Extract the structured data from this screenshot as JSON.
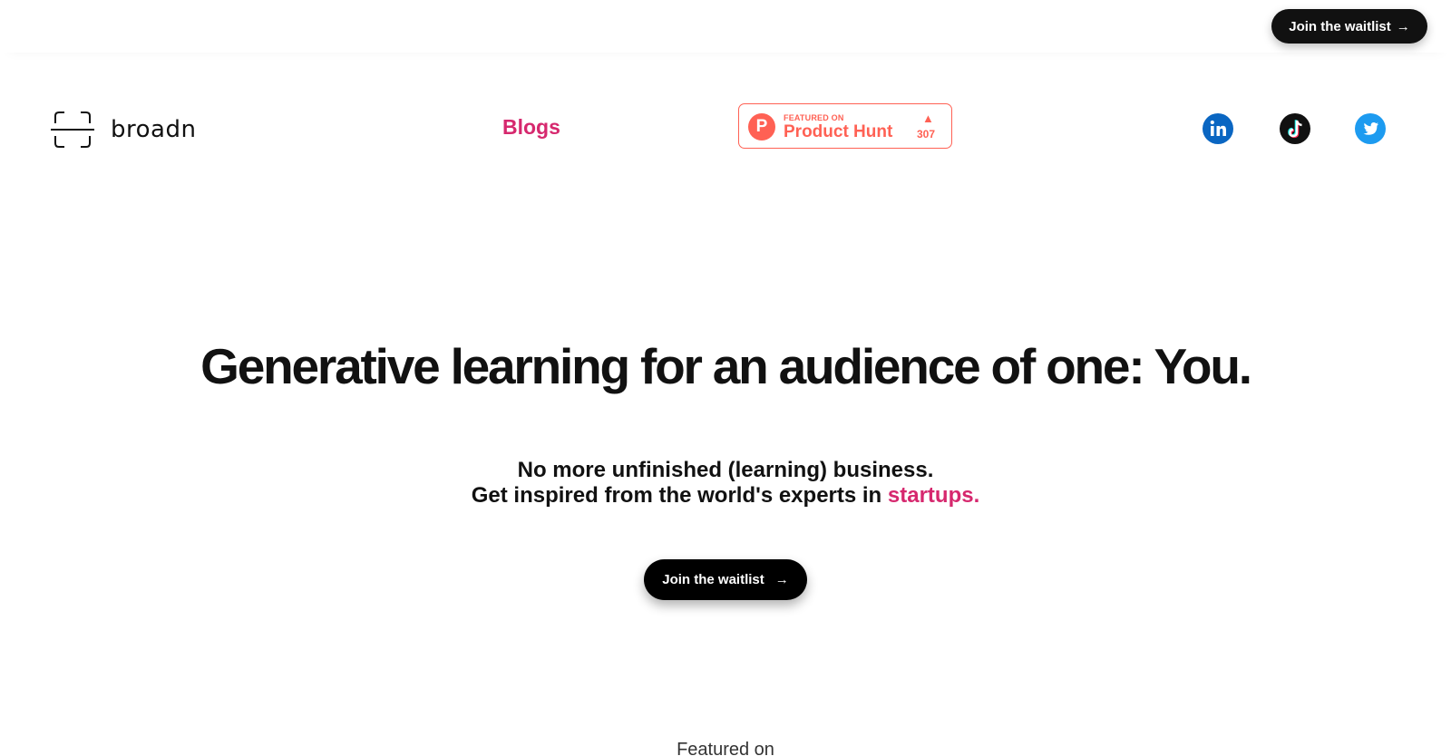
{
  "header": {
    "cta_label": "Join the waitlist",
    "cta_arrow": "→"
  },
  "nav": {
    "logo_text": "broadn",
    "blogs_label": "Blogs",
    "product_hunt": {
      "featured_label": "FEATURED ON",
      "name": "Product Hunt",
      "logo_letter": "P",
      "upvote_icon": "▲",
      "count": "307"
    },
    "socials": [
      "linkedin-icon",
      "tiktok-icon",
      "twitter-icon"
    ]
  },
  "hero": {
    "title": "Generative learning for an audience of one: You.",
    "line1": "No more unfinished (learning) business.",
    "line2_prefix": "Get inspired from the world's experts in",
    "line2_accent": "startups.",
    "cta_label": "Join the waitlist",
    "cta_arrow": "→"
  },
  "featured": {
    "label": "Featured on"
  },
  "colors": {
    "accent_pink": "#d6286e",
    "product_hunt": "#ff6154",
    "linkedin": "#0a66c2",
    "twitter": "#1d9bf0",
    "button_dark": "#111111"
  }
}
